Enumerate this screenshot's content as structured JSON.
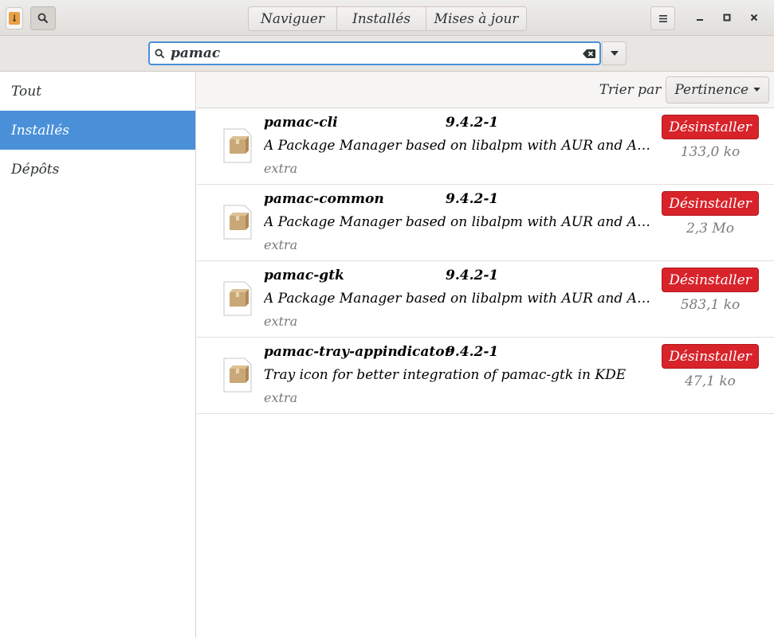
{
  "header": {
    "update_icon": "download-arrow-icon",
    "search_toggle_icon": "search-icon",
    "tabs": [
      {
        "label": "Naviguer"
      },
      {
        "label": "Installés"
      },
      {
        "label": "Mises à jour"
      }
    ],
    "menu_icon": "hamburger-menu-icon",
    "window_controls": [
      "minimize-icon",
      "maximize-icon",
      "close-icon"
    ]
  },
  "search": {
    "value": "pamac",
    "clear_icon": "clear-text-icon",
    "dropdown_icon": "chevron-down-icon"
  },
  "sidebar": {
    "items": [
      {
        "label": "Tout",
        "selected": false
      },
      {
        "label": "Installés",
        "selected": true
      },
      {
        "label": "Dépôts",
        "selected": false
      }
    ]
  },
  "sort": {
    "label": "Trier par",
    "selected": "Pertinence"
  },
  "packages": [
    {
      "name": "pamac-cli",
      "version": "9.4.2-1",
      "description": "A Package Manager based on libalpm with AUR and Appstre…",
      "repo": "extra",
      "action": "Désinstaller",
      "size": "133,0 ko"
    },
    {
      "name": "pamac-common",
      "version": "9.4.2-1",
      "description": "A Package Manager based on libalpm with AUR and Appstre…",
      "repo": "extra",
      "action": "Désinstaller",
      "size": "2,3 Mo"
    },
    {
      "name": "pamac-gtk",
      "version": "9.4.2-1",
      "description": "A Package Manager based on libalpm with AUR and Appstre…",
      "repo": "extra",
      "action": "Désinstaller",
      "size": "583,1 ko"
    },
    {
      "name": "pamac-tray-appindicator",
      "version": "9.4.2-1",
      "description": "Tray icon for better integration of pamac-gtk in KDE",
      "repo": "extra",
      "action": "Désinstaller",
      "size": "47,1 ko"
    }
  ],
  "colors": {
    "accent": "#4a90d9",
    "destructive": "#d8232a"
  }
}
